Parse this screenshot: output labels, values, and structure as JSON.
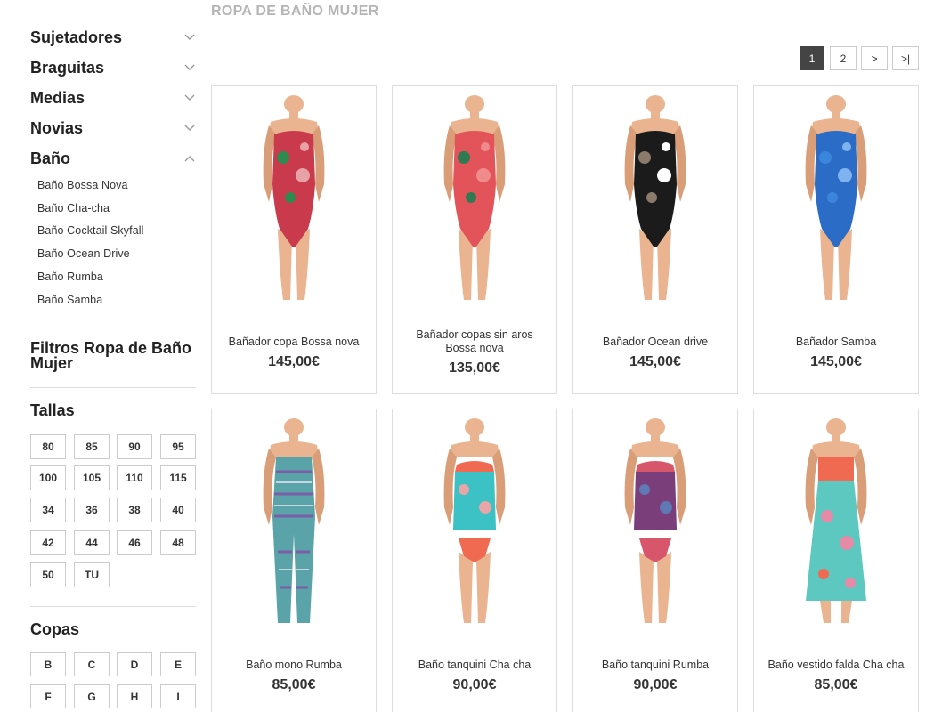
{
  "page_title": "ROPA DE BAÑO MUJER",
  "categories": [
    {
      "label": "Sujetadores",
      "open": false
    },
    {
      "label": "Braguitas",
      "open": false
    },
    {
      "label": "Medias",
      "open": false
    },
    {
      "label": "Novias",
      "open": false
    },
    {
      "label": "Baño",
      "open": true
    }
  ],
  "subcategories": [
    "Baño Bossa Nova",
    "Baño Cha-cha",
    "Baño Cocktail Skyfall",
    "Baño Ocean Drive",
    "Baño Rumba",
    "Baño Samba"
  ],
  "filters": {
    "title": "Filtros Ropa de Baño Mujer",
    "tallas": {
      "label": "Tallas",
      "options": [
        "80",
        "85",
        "90",
        "95",
        "100",
        "105",
        "110",
        "115",
        "34",
        "36",
        "38",
        "40",
        "42",
        "44",
        "46",
        "48",
        "50",
        "TU"
      ]
    },
    "copas": {
      "label": "Copas",
      "options": [
        "B",
        "C",
        "D",
        "E",
        "F",
        "G",
        "H",
        "I"
      ]
    }
  },
  "pagination": {
    "pages": [
      "1",
      "2"
    ],
    "next": ">",
    "last": ">|",
    "current": "1"
  },
  "products": [
    {
      "name": "Bañador copa Bossa nova",
      "price": "145,00€",
      "style": "swimsuit",
      "colors": [
        "#c93a4c",
        "#2f8a4f",
        "#e7a2a6"
      ]
    },
    {
      "name": "Bañador copas sin aros Bossa nova",
      "price": "135,00€",
      "style": "swimsuit",
      "colors": [
        "#e3545a",
        "#2d7a53",
        "#f08b8b"
      ]
    },
    {
      "name": "Bañador Ocean drive",
      "price": "145,00€",
      "style": "swimsuit",
      "colors": [
        "#1b1b1b",
        "#8a7b6b",
        "#ffffff"
      ]
    },
    {
      "name": "Bañador Samba",
      "price": "145,00€",
      "style": "swimsuit",
      "colors": [
        "#2b6cc6",
        "#3b86dd",
        "#7fb3f0"
      ]
    },
    {
      "name": "Baño mono Rumba",
      "price": "85,00€",
      "style": "jumpsuit",
      "colors": [
        "#5aa3a8",
        "#7b5ea7",
        "#c7d6e0"
      ]
    },
    {
      "name": "Baño tanquini Cha cha",
      "price": "90,00€",
      "style": "tankini",
      "colors": [
        "#3cc1c4",
        "#f06a52",
        "#e9a5a8"
      ]
    },
    {
      "name": "Baño tanquini Rumba",
      "price": "90,00€",
      "style": "tankini",
      "colors": [
        "#7a3f7b",
        "#d8566c",
        "#5f79b5"
      ]
    },
    {
      "name": "Baño vestido falda Cha cha",
      "price": "85,00€",
      "style": "dress",
      "colors": [
        "#f06a52",
        "#5cc8c0",
        "#e58aa7"
      ]
    }
  ]
}
